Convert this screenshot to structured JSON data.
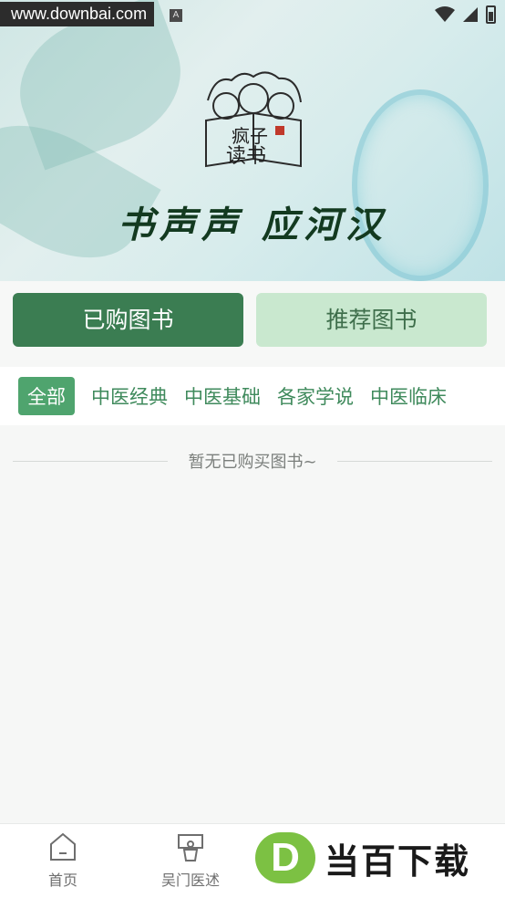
{
  "status_bar": {
    "watermark": "www.downbai.com",
    "indicator": "A"
  },
  "banner": {
    "slogan": "书声声 应河汉",
    "logo_text": "疯子读书"
  },
  "tabs": [
    {
      "label": "已购图书",
      "active": true
    },
    {
      "label": "推荐图书",
      "active": false
    }
  ],
  "categories": [
    {
      "label": "全部",
      "active": true
    },
    {
      "label": "中医经典",
      "active": false
    },
    {
      "label": "中医基础",
      "active": false
    },
    {
      "label": "各家学说",
      "active": false
    },
    {
      "label": "中医临床",
      "active": false
    }
  ],
  "empty_message": "暂无已购买图书~",
  "bottom_nav": [
    {
      "label": "首页",
      "icon": "home-icon"
    },
    {
      "label": "吴门医述",
      "icon": "lecture-icon"
    }
  ],
  "ad_overlay": {
    "badge": "D",
    "text": "当百下载"
  },
  "colors": {
    "primary": "#3b7d52",
    "secondary": "#c9e8cf",
    "category": "#3f8a5c"
  }
}
